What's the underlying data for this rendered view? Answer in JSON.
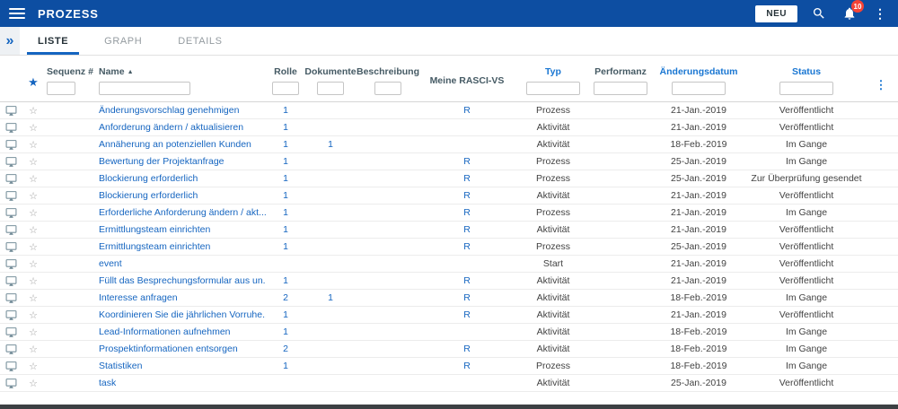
{
  "app_bar": {
    "title": "PROZESS",
    "neu_button": "NEU",
    "notification_count": "10"
  },
  "tabs": [
    {
      "label": "LISTE",
      "active": true
    },
    {
      "label": "GRAPH",
      "active": false
    },
    {
      "label": "DETAILS",
      "active": false
    }
  ],
  "icons": {
    "favorite_filled": "★",
    "favorite_outline": "☆",
    "more_vertical": "⋮",
    "sort_asc": "▲",
    "expand": "»"
  },
  "colors": {
    "appbar_blue": "#0d4ea2",
    "link_blue": "#1565c0",
    "header_highlight_blue": "#1976d2",
    "badge_red": "#f44336"
  },
  "table": {
    "columns": [
      {
        "label": "",
        "name": "viewer"
      },
      {
        "label": "",
        "name": "favorite"
      },
      {
        "label": "Sequenz #",
        "highlighted": false
      },
      {
        "label": "Name",
        "highlighted": false,
        "sorted": "asc"
      },
      {
        "label": "Rolle",
        "highlighted": false
      },
      {
        "label": "Dokumente",
        "highlighted": false
      },
      {
        "label": "Beschreibung",
        "highlighted": false
      },
      {
        "label": "Meine RASCI-VS",
        "highlighted": false
      },
      {
        "label": "Typ",
        "highlighted": true
      },
      {
        "label": "Performanz",
        "highlighted": false
      },
      {
        "label": "Änderungsdatum",
        "highlighted": true
      },
      {
        "label": "Status",
        "highlighted": true
      }
    ],
    "rows": [
      {
        "sequenz": "",
        "name": "Änderungsvorschlag genehmigen",
        "rolle": "1",
        "dokumente": "",
        "beschreibung": "",
        "rasci": "R",
        "typ": "Prozess",
        "performanz": "",
        "datum": "21-Jan.-2019",
        "status": "Veröffentlicht"
      },
      {
        "sequenz": "",
        "name": "Anforderung ändern / aktualisieren",
        "rolle": "1",
        "dokumente": "",
        "beschreibung": "",
        "rasci": "",
        "typ": "Aktivität",
        "performanz": "",
        "datum": "21-Jan.-2019",
        "status": "Veröffentlicht"
      },
      {
        "sequenz": "",
        "name": "Annäherung an potenziellen Kunden",
        "rolle": "1",
        "dokumente": "1",
        "beschreibung": "",
        "rasci": "",
        "typ": "Aktivität",
        "performanz": "",
        "datum": "18-Feb.-2019",
        "status": "Im Gange"
      },
      {
        "sequenz": "",
        "name": "Bewertung der Projektanfrage",
        "rolle": "1",
        "dokumente": "",
        "beschreibung": "",
        "rasci": "R",
        "typ": "Prozess",
        "performanz": "",
        "datum": "25-Jan.-2019",
        "status": "Im Gange"
      },
      {
        "sequenz": "",
        "name": "Blockierung erforderlich",
        "rolle": "1",
        "dokumente": "",
        "beschreibung": "",
        "rasci": "R",
        "typ": "Prozess",
        "performanz": "",
        "datum": "25-Jan.-2019",
        "status": "Zur Überprüfung gesendet"
      },
      {
        "sequenz": "",
        "name": "Blockierung erforderlich",
        "rolle": "1",
        "dokumente": "",
        "beschreibung": "",
        "rasci": "R",
        "typ": "Aktivität",
        "performanz": "",
        "datum": "21-Jan.-2019",
        "status": "Veröffentlicht"
      },
      {
        "sequenz": "",
        "name": "Erforderliche Anforderung ändern / akt...",
        "rolle": "1",
        "dokumente": "",
        "beschreibung": "",
        "rasci": "R",
        "typ": "Prozess",
        "performanz": "",
        "datum": "21-Jan.-2019",
        "status": "Im Gange"
      },
      {
        "sequenz": "",
        "name": "Ermittlungsteam einrichten",
        "rolle": "1",
        "dokumente": "",
        "beschreibung": "",
        "rasci": "R",
        "typ": "Aktivität",
        "performanz": "",
        "datum": "21-Jan.-2019",
        "status": "Veröffentlicht"
      },
      {
        "sequenz": "",
        "name": "Ermittlungsteam einrichten",
        "rolle": "1",
        "dokumente": "",
        "beschreibung": "",
        "rasci": "R",
        "typ": "Prozess",
        "performanz": "",
        "datum": "25-Jan.-2019",
        "status": "Veröffentlicht"
      },
      {
        "sequenz": "",
        "name": "event",
        "rolle": "",
        "dokumente": "",
        "beschreibung": "",
        "rasci": "",
        "typ": "Start",
        "performanz": "",
        "datum": "21-Jan.-2019",
        "status": "Veröffentlicht"
      },
      {
        "sequenz": "",
        "name": "Füllt das Besprechungsformular aus un...",
        "rolle": "1",
        "dokumente": "",
        "beschreibung": "",
        "rasci": "R",
        "typ": "Aktivität",
        "performanz": "",
        "datum": "21-Jan.-2019",
        "status": "Veröffentlicht"
      },
      {
        "sequenz": "",
        "name": "Interesse anfragen",
        "rolle": "2",
        "dokumente": "1",
        "beschreibung": "",
        "rasci": "R",
        "typ": "Aktivität",
        "performanz": "",
        "datum": "18-Feb.-2019",
        "status": "Im Gange"
      },
      {
        "sequenz": "",
        "name": "Koordinieren Sie die jährlichen Vorruhe...",
        "rolle": "1",
        "dokumente": "",
        "beschreibung": "",
        "rasci": "R",
        "typ": "Aktivität",
        "performanz": "",
        "datum": "21-Jan.-2019",
        "status": "Veröffentlicht"
      },
      {
        "sequenz": "",
        "name": "Lead-Informationen aufnehmen",
        "rolle": "1",
        "dokumente": "",
        "beschreibung": "",
        "rasci": "",
        "typ": "Aktivität",
        "performanz": "",
        "datum": "18-Feb.-2019",
        "status": "Im Gange"
      },
      {
        "sequenz": "",
        "name": "Prospektinformationen entsorgen",
        "rolle": "2",
        "dokumente": "",
        "beschreibung": "",
        "rasci": "R",
        "typ": "Aktivität",
        "performanz": "",
        "datum": "18-Feb.-2019",
        "status": "Im Gange"
      },
      {
        "sequenz": "",
        "name": "Statistiken",
        "rolle": "1",
        "dokumente": "",
        "beschreibung": "",
        "rasci": "R",
        "typ": "Prozess",
        "performanz": "",
        "datum": "18-Feb.-2019",
        "status": "Im Gange"
      },
      {
        "sequenz": "",
        "name": "task",
        "rolle": "",
        "dokumente": "",
        "beschreibung": "",
        "rasci": "",
        "typ": "Aktivität",
        "performanz": "",
        "datum": "25-Jan.-2019",
        "status": "Veröffentlicht"
      }
    ]
  }
}
